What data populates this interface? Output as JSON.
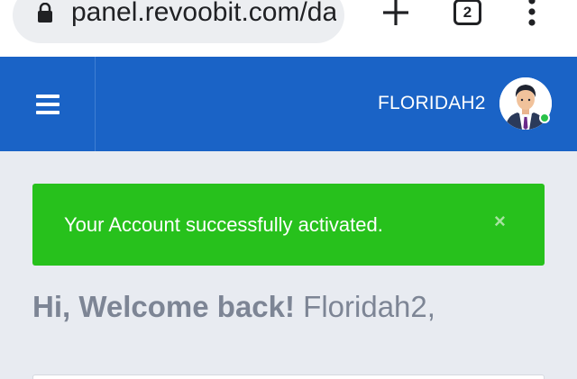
{
  "browser": {
    "url": "panel.revoobit.com/dasl",
    "tab_count": "2",
    "icons": {
      "lock": "lock-icon",
      "new_tab": "plus-icon",
      "tabs": "tabs-icon",
      "menu": "more-vert-icon"
    }
  },
  "header": {
    "username": "FLORIDAH2",
    "icons": {
      "menu": "hamburger-icon",
      "avatar": "user-avatar",
      "status": "online-dot"
    },
    "status": "online"
  },
  "alert": {
    "message": "Your Account successfully activated.",
    "close_glyph": "×"
  },
  "welcome": {
    "greeting": "Hi, Welcome back!",
    "name": "Floridah2,"
  },
  "colors": {
    "header_blue": "#1a63c6",
    "success_green": "#27c11c",
    "page_bg": "#e8ebf1",
    "welcome_text": "#7d8595"
  }
}
